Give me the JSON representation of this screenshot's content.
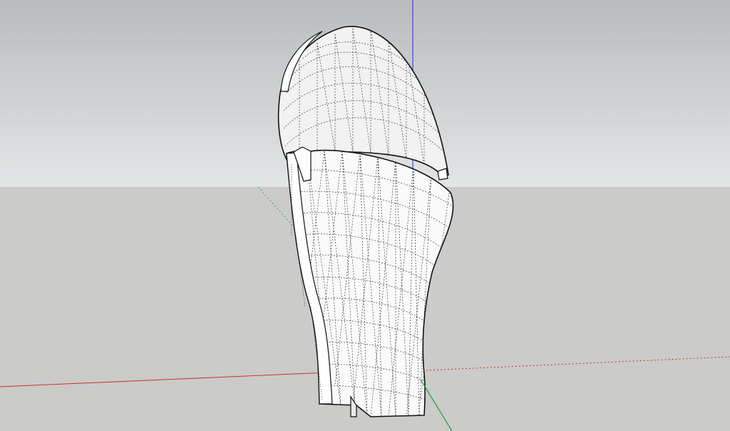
{
  "viewport": {
    "sky_color_top": "#b9bcbd",
    "sky_color_bottom": "#e3e5e6",
    "ground_color": "#cbcbc9",
    "axis_colors": {
      "red": "#c0392b",
      "green": "#2e9a3a",
      "blue": "#2b2bd1"
    },
    "model": {
      "kind": "3d-surface-mesh",
      "edge_style": "dashed-hidden-lines",
      "face_color": "#ffffff",
      "outline_color": "#111111"
    }
  }
}
